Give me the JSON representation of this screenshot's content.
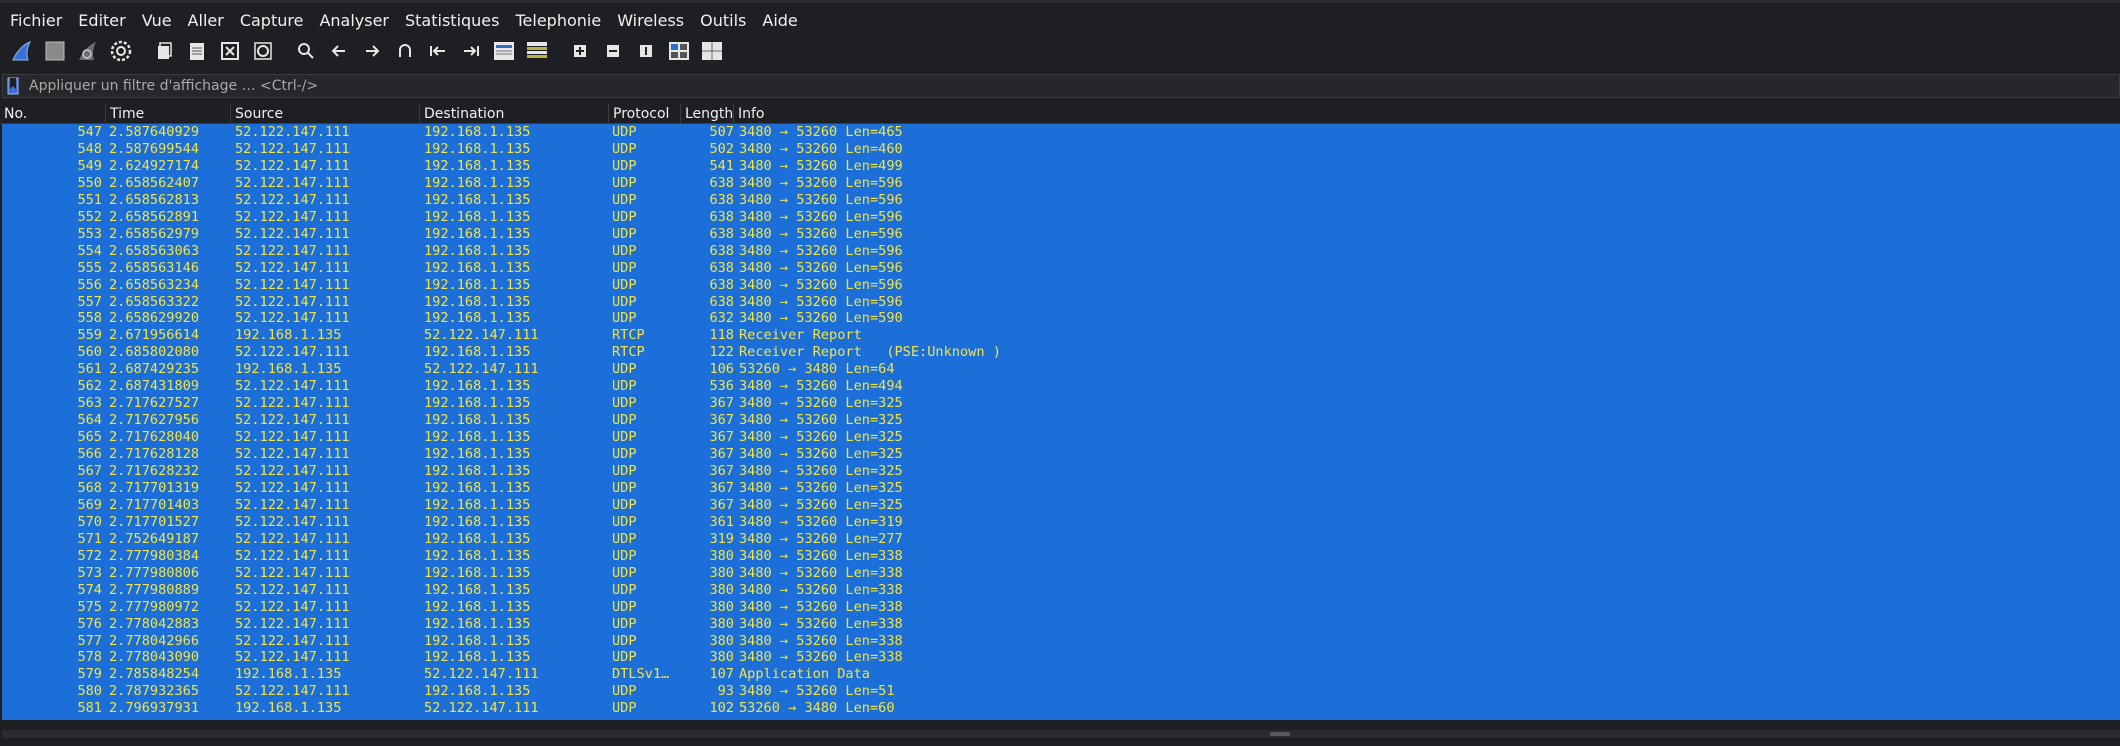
{
  "menu": [
    "Fichier",
    "Editer",
    "Vue",
    "Aller",
    "Capture",
    "Analyser",
    "Statistiques",
    "Telephonie",
    "Wireless",
    "Outils",
    "Aide"
  ],
  "toolbar": {
    "icons": [
      "shark-fin-start-icon",
      "stop-square-icon",
      "restart-fin-icon",
      "capture-options-gear-icon",
      "open-file-icon",
      "save-file-icon",
      "close-file-icon",
      "reload-file-icon",
      "find-packet-icon",
      "go-back-icon",
      "go-forward-icon",
      "go-to-packet-icon",
      "first-packet-icon",
      "last-packet-icon",
      "autoscroll-icon",
      "colorize-icon",
      "zoom-in-icon",
      "zoom-out-icon",
      "normal-size-icon",
      "resize-columns-icon",
      "layout-icon"
    ]
  },
  "filter": {
    "placeholder": "Appliquer un filtre d'affichage … <Ctrl-/>",
    "value": ""
  },
  "columns": [
    "No.",
    "Time",
    "Source",
    "Destination",
    "Protocol",
    "Length",
    "Info"
  ],
  "packets": [
    {
      "no": "547",
      "time": "2.587640929",
      "source": "52.122.147.111",
      "destination": "192.168.1.135",
      "protocol": "UDP",
      "length": "507",
      "info": "3480 → 53260 Len=465"
    },
    {
      "no": "548",
      "time": "2.587699544",
      "source": "52.122.147.111",
      "destination": "192.168.1.135",
      "protocol": "UDP",
      "length": "502",
      "info": "3480 → 53260 Len=460"
    },
    {
      "no": "549",
      "time": "2.624927174",
      "source": "52.122.147.111",
      "destination": "192.168.1.135",
      "protocol": "UDP",
      "length": "541",
      "info": "3480 → 53260 Len=499"
    },
    {
      "no": "550",
      "time": "2.658562407",
      "source": "52.122.147.111",
      "destination": "192.168.1.135",
      "protocol": "UDP",
      "length": "638",
      "info": "3480 → 53260 Len=596"
    },
    {
      "no": "551",
      "time": "2.658562813",
      "source": "52.122.147.111",
      "destination": "192.168.1.135",
      "protocol": "UDP",
      "length": "638",
      "info": "3480 → 53260 Len=596"
    },
    {
      "no": "552",
      "time": "2.658562891",
      "source": "52.122.147.111",
      "destination": "192.168.1.135",
      "protocol": "UDP",
      "length": "638",
      "info": "3480 → 53260 Len=596"
    },
    {
      "no": "553",
      "time": "2.658562979",
      "source": "52.122.147.111",
      "destination": "192.168.1.135",
      "protocol": "UDP",
      "length": "638",
      "info": "3480 → 53260 Len=596"
    },
    {
      "no": "554",
      "time": "2.658563063",
      "source": "52.122.147.111",
      "destination": "192.168.1.135",
      "protocol": "UDP",
      "length": "638",
      "info": "3480 → 53260 Len=596"
    },
    {
      "no": "555",
      "time": "2.658563146",
      "source": "52.122.147.111",
      "destination": "192.168.1.135",
      "protocol": "UDP",
      "length": "638",
      "info": "3480 → 53260 Len=596"
    },
    {
      "no": "556",
      "time": "2.658563234",
      "source": "52.122.147.111",
      "destination": "192.168.1.135",
      "protocol": "UDP",
      "length": "638",
      "info": "3480 → 53260 Len=596"
    },
    {
      "no": "557",
      "time": "2.658563322",
      "source": "52.122.147.111",
      "destination": "192.168.1.135",
      "protocol": "UDP",
      "length": "638",
      "info": "3480 → 53260 Len=596"
    },
    {
      "no": "558",
      "time": "2.658629920",
      "source": "52.122.147.111",
      "destination": "192.168.1.135",
      "protocol": "UDP",
      "length": "632",
      "info": "3480 → 53260 Len=590"
    },
    {
      "no": "559",
      "time": "2.671956614",
      "source": "192.168.1.135",
      "destination": "52.122.147.111",
      "protocol": "RTCP",
      "length": "118",
      "info": "Receiver Report"
    },
    {
      "no": "560",
      "time": "2.685802080",
      "source": "52.122.147.111",
      "destination": "192.168.1.135",
      "protocol": "RTCP",
      "length": "122",
      "info": "Receiver Report   (PSE:Unknown )"
    },
    {
      "no": "561",
      "time": "2.687429235",
      "source": "192.168.1.135",
      "destination": "52.122.147.111",
      "protocol": "UDP",
      "length": "106",
      "info": "53260 → 3480 Len=64"
    },
    {
      "no": "562",
      "time": "2.687431809",
      "source": "52.122.147.111",
      "destination": "192.168.1.135",
      "protocol": "UDP",
      "length": "536",
      "info": "3480 → 53260 Len=494"
    },
    {
      "no": "563",
      "time": "2.717627527",
      "source": "52.122.147.111",
      "destination": "192.168.1.135",
      "protocol": "UDP",
      "length": "367",
      "info": "3480 → 53260 Len=325"
    },
    {
      "no": "564",
      "time": "2.717627956",
      "source": "52.122.147.111",
      "destination": "192.168.1.135",
      "protocol": "UDP",
      "length": "367",
      "info": "3480 → 53260 Len=325"
    },
    {
      "no": "565",
      "time": "2.717628040",
      "source": "52.122.147.111",
      "destination": "192.168.1.135",
      "protocol": "UDP",
      "length": "367",
      "info": "3480 → 53260 Len=325"
    },
    {
      "no": "566",
      "time": "2.717628128",
      "source": "52.122.147.111",
      "destination": "192.168.1.135",
      "protocol": "UDP",
      "length": "367",
      "info": "3480 → 53260 Len=325"
    },
    {
      "no": "567",
      "time": "2.717628232",
      "source": "52.122.147.111",
      "destination": "192.168.1.135",
      "protocol": "UDP",
      "length": "367",
      "info": "3480 → 53260 Len=325"
    },
    {
      "no": "568",
      "time": "2.717701319",
      "source": "52.122.147.111",
      "destination": "192.168.1.135",
      "protocol": "UDP",
      "length": "367",
      "info": "3480 → 53260 Len=325"
    },
    {
      "no": "569",
      "time": "2.717701403",
      "source": "52.122.147.111",
      "destination": "192.168.1.135",
      "protocol": "UDP",
      "length": "367",
      "info": "3480 → 53260 Len=325"
    },
    {
      "no": "570",
      "time": "2.717701527",
      "source": "52.122.147.111",
      "destination": "192.168.1.135",
      "protocol": "UDP",
      "length": "361",
      "info": "3480 → 53260 Len=319"
    },
    {
      "no": "571",
      "time": "2.752649187",
      "source": "52.122.147.111",
      "destination": "192.168.1.135",
      "protocol": "UDP",
      "length": "319",
      "info": "3480 → 53260 Len=277"
    },
    {
      "no": "572",
      "time": "2.777980384",
      "source": "52.122.147.111",
      "destination": "192.168.1.135",
      "protocol": "UDP",
      "length": "380",
      "info": "3480 → 53260 Len=338"
    },
    {
      "no": "573",
      "time": "2.777980806",
      "source": "52.122.147.111",
      "destination": "192.168.1.135",
      "protocol": "UDP",
      "length": "380",
      "info": "3480 → 53260 Len=338"
    },
    {
      "no": "574",
      "time": "2.777980889",
      "source": "52.122.147.111",
      "destination": "192.168.1.135",
      "protocol": "UDP",
      "length": "380",
      "info": "3480 → 53260 Len=338"
    },
    {
      "no": "575",
      "time": "2.777980972",
      "source": "52.122.147.111",
      "destination": "192.168.1.135",
      "protocol": "UDP",
      "length": "380",
      "info": "3480 → 53260 Len=338"
    },
    {
      "no": "576",
      "time": "2.778042883",
      "source": "52.122.147.111",
      "destination": "192.168.1.135",
      "protocol": "UDP",
      "length": "380",
      "info": "3480 → 53260 Len=338"
    },
    {
      "no": "577",
      "time": "2.778042966",
      "source": "52.122.147.111",
      "destination": "192.168.1.135",
      "protocol": "UDP",
      "length": "380",
      "info": "3480 → 53260 Len=338"
    },
    {
      "no": "578",
      "time": "2.778043090",
      "source": "52.122.147.111",
      "destination": "192.168.1.135",
      "protocol": "UDP",
      "length": "380",
      "info": "3480 → 53260 Len=338"
    },
    {
      "no": "579",
      "time": "2.785848254",
      "source": "192.168.1.135",
      "destination": "52.122.147.111",
      "protocol": "DTLSv1…",
      "length": "107",
      "info": "Application Data"
    },
    {
      "no": "580",
      "time": "2.787932365",
      "source": "52.122.147.111",
      "destination": "192.168.1.135",
      "protocol": "UDP",
      "length": "93",
      "info": "3480 → 53260 Len=51"
    },
    {
      "no": "581",
      "time": "2.796937931",
      "source": "192.168.1.135",
      "destination": "52.122.147.111",
      "protocol": "UDP",
      "length": "102",
      "info": "53260 → 3480 Len=60"
    }
  ],
  "colors": {
    "background": "#1d1f23",
    "selection": "#1c6fd8",
    "row_text": "#f2e44b",
    "accent_blue": "#3a6fd8"
  }
}
